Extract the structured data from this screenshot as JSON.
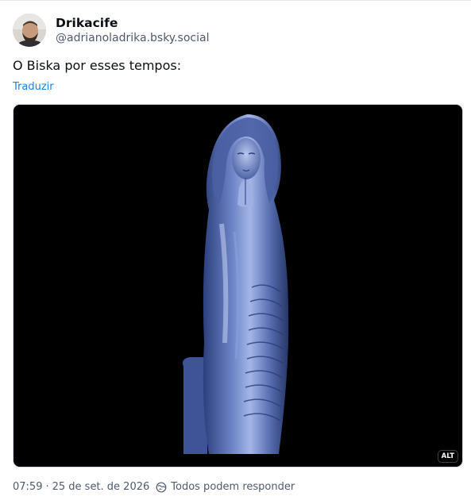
{
  "author": {
    "display_name": "Drikacife",
    "handle": "@adrianoladrika.bsky.social",
    "avatar_icon": "person-avatar"
  },
  "post": {
    "text": "O Biska por esses tempos:",
    "translate_label": "Traduzir"
  },
  "media": {
    "alt_badge": "ALT"
  },
  "meta": {
    "time": "07:59",
    "separator": "·",
    "date": "25 de set. de 2026",
    "reply_setting_icon": "globe-icon",
    "reply_setting": "Todos podem responder"
  },
  "colors": {
    "link": "#1083fe",
    "muted": "#4f5b6b",
    "text": "#0b0f14",
    "media_bg": "#000000",
    "statue": "#6f86c8"
  }
}
